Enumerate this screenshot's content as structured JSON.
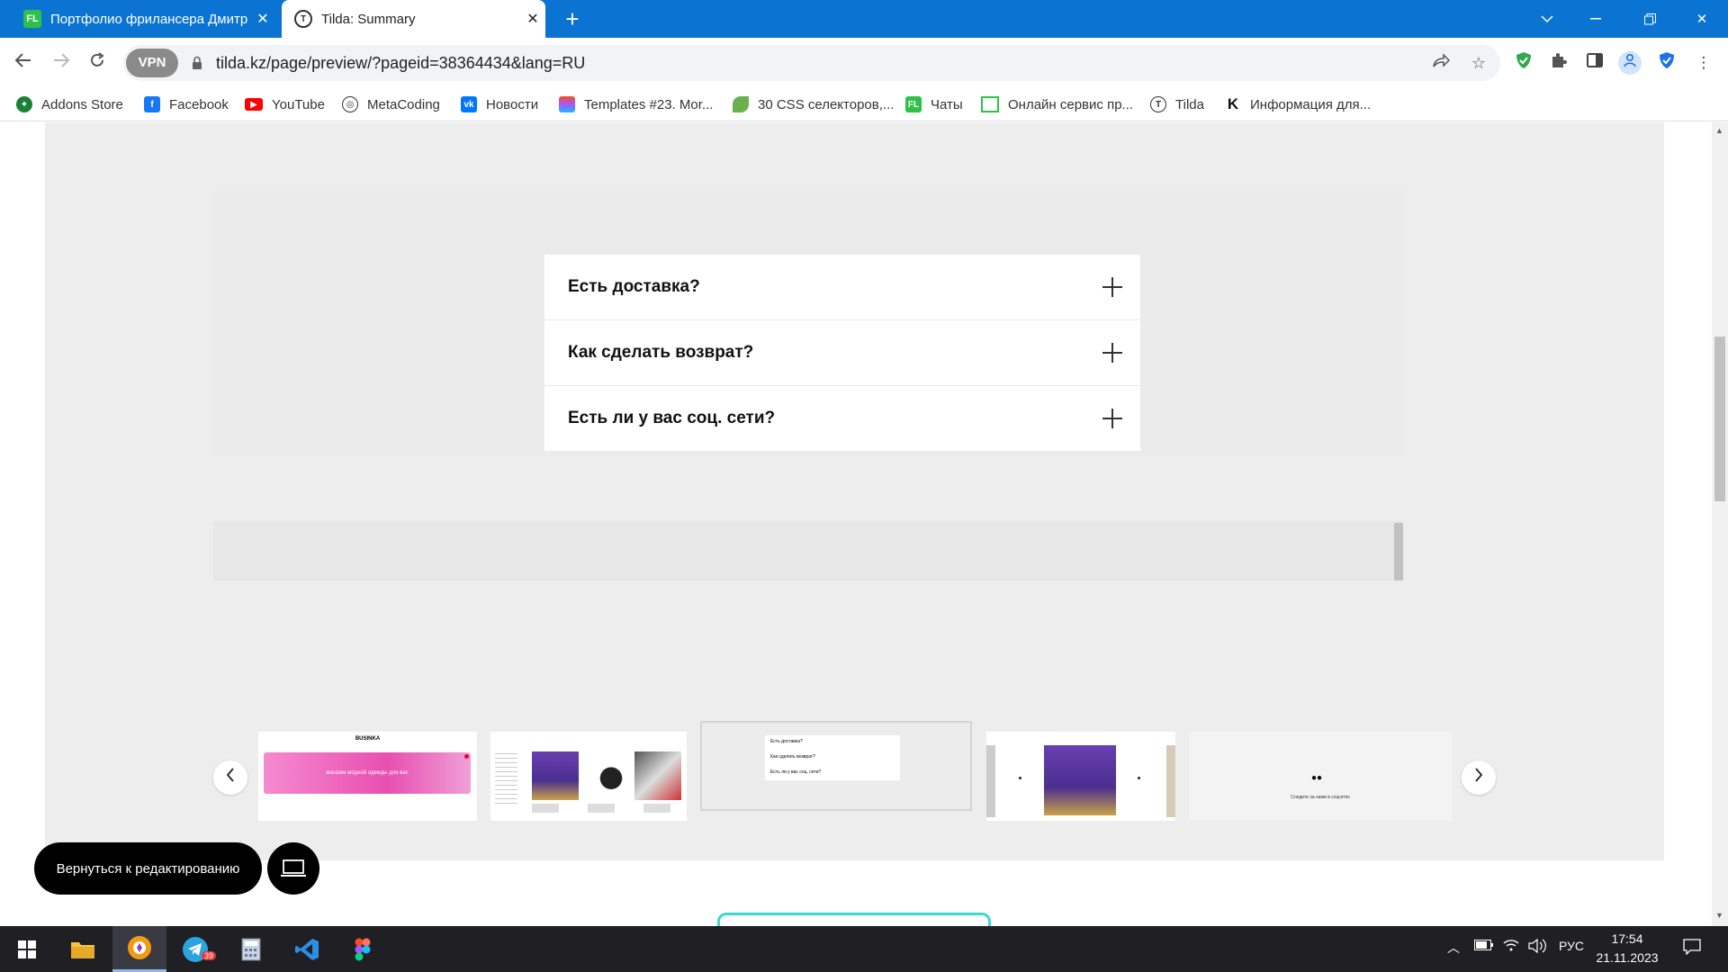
{
  "browser": {
    "tabs": [
      {
        "title": "Портфолио фрилансера Дмитр",
        "favicon": "FL",
        "active": false
      },
      {
        "title": "Tilda: Summary",
        "favicon": "T",
        "active": true
      }
    ],
    "url": "tilda.kz/page/preview/?pageid=38364434&lang=RU",
    "vpn_label": "VPN",
    "accent": "#0b74d3"
  },
  "bookmarks": [
    {
      "label": "Addons Store",
      "icon": "addons-icon",
      "color": "#1a7f37"
    },
    {
      "label": "Facebook",
      "icon": "facebook-icon",
      "color": "#1877f2"
    },
    {
      "label": "YouTube",
      "icon": "youtube-icon",
      "color": "#ff0000"
    },
    {
      "label": "MetaCoding",
      "icon": "metacoding-icon",
      "color": "#333333"
    },
    {
      "label": "Новости",
      "icon": "vk-icon",
      "color": "#0077ff"
    },
    {
      "label": "Templates #23. Mor...",
      "icon": "figma-icon",
      "color": "#f24e1e"
    },
    {
      "label": "30 CSS селекторов,...",
      "icon": "leaf-icon",
      "color": "#6ab04c"
    },
    {
      "label": "Чаты",
      "icon": "fl-icon",
      "color": "#2ec04a"
    },
    {
      "label": "Онлайн сервис пр...",
      "icon": "frame-icon",
      "color": "#2ec04a"
    },
    {
      "label": "Tilda",
      "icon": "tilda-icon",
      "color": "#333333"
    },
    {
      "label": "Информация для...",
      "icon": "k-icon",
      "color": "#111111"
    }
  ],
  "faq": {
    "items": [
      {
        "question": "Есть доставка?"
      },
      {
        "question": "Как сделать возврат?"
      },
      {
        "question": "Есть ли у вас соц. сети?"
      }
    ]
  },
  "thumbnails": {
    "t1_brand": "BUSINKA",
    "t1_banner": "магазин модной одежды для вас",
    "t3_q1": "Есть доставка?",
    "t3_q2": "Как сделать возврат?",
    "t3_q3": "Есть ли у вас соц. сети?",
    "t5_caption": "Следите за нами в соцсетях"
  },
  "preview": {
    "back_label": "Вернуться к редактированию"
  },
  "taskbar": {
    "telegram_badge": "39",
    "lang": "РУС",
    "time": "17:54",
    "date": "21.11.2023"
  }
}
